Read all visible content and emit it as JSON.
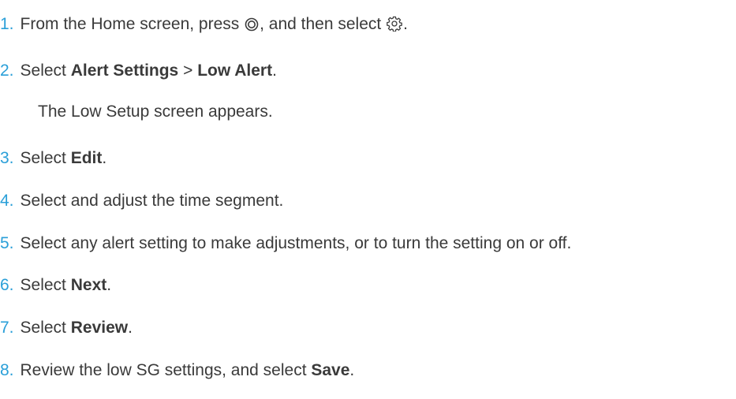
{
  "steps": [
    {
      "number": "1.",
      "segments": [
        {
          "text": "From the Home screen, press ",
          "bold": false
        },
        {
          "icon": "menu-button-icon"
        },
        {
          "text": ", and then select ",
          "bold": false
        },
        {
          "icon": "gear-icon"
        },
        {
          "text": ".",
          "bold": false
        }
      ]
    },
    {
      "number": "2.",
      "segments": [
        {
          "text": "Select ",
          "bold": false
        },
        {
          "text": "Alert Settings",
          "bold": true
        },
        {
          "text": " > ",
          "bold": false
        },
        {
          "text": "Low Alert",
          "bold": true
        },
        {
          "text": ".",
          "bold": false
        }
      ],
      "note": "The Low Setup screen appears."
    },
    {
      "number": "3.",
      "segments": [
        {
          "text": "Select ",
          "bold": false
        },
        {
          "text": "Edit",
          "bold": true
        },
        {
          "text": ".",
          "bold": false
        }
      ]
    },
    {
      "number": "4.",
      "segments": [
        {
          "text": "Select and adjust the time segment.",
          "bold": false
        }
      ]
    },
    {
      "number": "5.",
      "segments": [
        {
          "text": "Select any alert setting to make adjustments, or to turn the setting on or off.",
          "bold": false
        }
      ]
    },
    {
      "number": "6.",
      "segments": [
        {
          "text": "Select ",
          "bold": false
        },
        {
          "text": "Next",
          "bold": true
        },
        {
          "text": ".",
          "bold": false
        }
      ]
    },
    {
      "number": "7.",
      "segments": [
        {
          "text": "Select ",
          "bold": false
        },
        {
          "text": "Review",
          "bold": true
        },
        {
          "text": ".",
          "bold": false
        }
      ]
    },
    {
      "number": "8.",
      "segments": [
        {
          "text": "Review the low SG settings, and select ",
          "bold": false
        },
        {
          "text": "Save",
          "bold": true
        },
        {
          "text": ".",
          "bold": false
        }
      ]
    }
  ]
}
